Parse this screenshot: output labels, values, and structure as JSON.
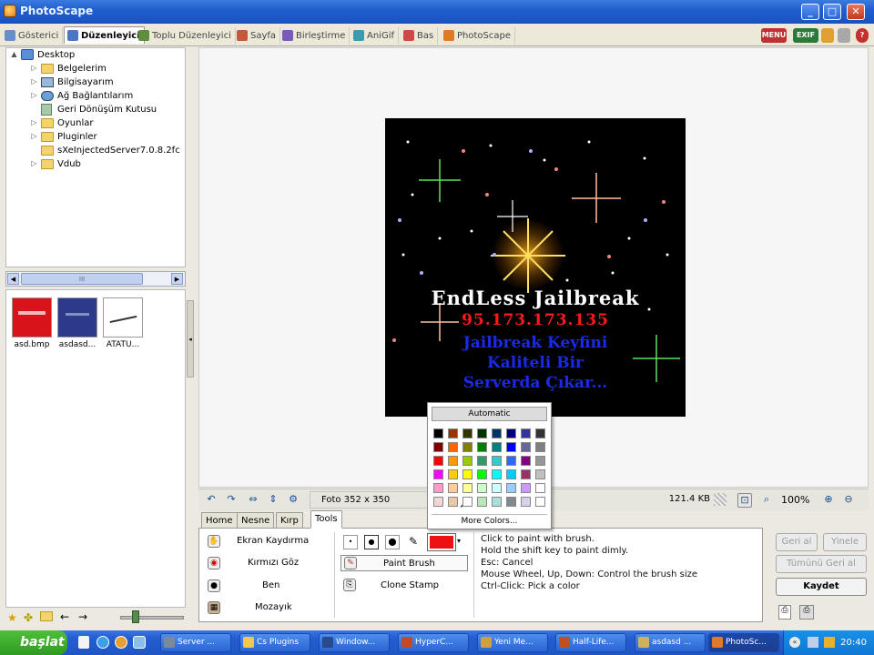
{
  "window": {
    "title": "PhotoScape"
  },
  "tabs": [
    {
      "label": "Gösterici",
      "color": "#6a8fc8"
    },
    {
      "label": "Düzenleyici",
      "color": "#4a76c4"
    },
    {
      "label": "Toplu Düzenleyici",
      "color": "#5e8e3c"
    },
    {
      "label": "Sayfa",
      "color": "#c05a3a"
    },
    {
      "label": "Birleştirme",
      "color": "#7a5ab8"
    },
    {
      "label": "AniGif",
      "color": "#3a9ab2"
    },
    {
      "label": "Bas",
      "color": "#d04848"
    },
    {
      "label": "PhotoScape",
      "color": "#e07a2a"
    }
  ],
  "toolbar_right": {
    "menu": "MENU",
    "exif": "EXIF"
  },
  "tree": [
    {
      "label": "Desktop",
      "expander": "▲",
      "level": 0
    },
    {
      "label": "Belgelerim",
      "expander": "▷",
      "level": 1
    },
    {
      "label": "Bilgisayarım",
      "expander": "▷",
      "level": 1
    },
    {
      "label": "Ağ Bağlantılarım",
      "expander": "▷",
      "level": 1
    },
    {
      "label": "Geri Dönüşüm Kutusu",
      "expander": "",
      "level": 1
    },
    {
      "label": "Oyunlar",
      "expander": "▷",
      "level": 1
    },
    {
      "label": "Pluginler",
      "expander": "▷",
      "level": 1
    },
    {
      "label": "sXeInjectedServer7.0.8.2fc",
      "expander": "",
      "level": 1
    },
    {
      "label": "Vdub",
      "expander": "▷",
      "level": 1
    }
  ],
  "scroll_grip": "III",
  "thumbnails": [
    {
      "caption": "asd.bmp",
      "bg": "#d8141a"
    },
    {
      "caption": "asdasd...",
      "bg": "#2c3a8c"
    },
    {
      "caption": "ATATÜ...",
      "bg": "#ffffff"
    }
  ],
  "photo": {
    "title": "EndLess Jailbreak",
    "ip": "95.173.173.135",
    "line1": "Jailbreak Keyfini",
    "line2": "Kaliteli Bir",
    "line3": "Serverda Çıkar..."
  },
  "statusbar": {
    "photo_size": "Foto 352 x 350",
    "file_size": "121.4 KB",
    "zoom": "100%"
  },
  "tool_tabs": [
    "Home",
    "Nesne",
    "Kırp",
    "Tools"
  ],
  "tools_left": [
    "Ekran Kaydırma",
    "Kırmızı Göz",
    "Ben",
    "Mozayık"
  ],
  "tools_mid": [
    "Paint Brush",
    "Clone Stamp"
  ],
  "brush_color": "#ee1111",
  "help_lines": [
    "Click to paint with brush.",
    "Hold the shift key to paint dimly.",
    "Esc: Cancel",
    "Mouse Wheel, Up, Down: Control the brush size",
    "Ctrl-Click: Pick a color"
  ],
  "right_buttons": {
    "undo": "Geri al",
    "redo": "Yinele",
    "undo_all": "Tümünü Geri al",
    "save": "Kaydet"
  },
  "palette": {
    "automatic": "Automatic",
    "more": "More Colors...",
    "rows": [
      [
        "#000000",
        "#993300",
        "#333300",
        "#003300",
        "#003366",
        "#000080",
        "#333399",
        "#333333"
      ],
      [
        "#800000",
        "#ff6600",
        "#808000",
        "#008000",
        "#008080",
        "#0000ff",
        "#666699",
        "#808080"
      ],
      [
        "#ff0000",
        "#ff9900",
        "#99cc00",
        "#339966",
        "#33cccc",
        "#3366ff",
        "#800080",
        "#969696"
      ],
      [
        "#ff00ff",
        "#ffcc00",
        "#ffff00",
        "#00ff00",
        "#00ffff",
        "#00ccff",
        "#993366",
        "#c0c0c0"
      ],
      [
        "#ff99cc",
        "#ffcc99",
        "#ffff99",
        "#ccffcc",
        "#ccffff",
        "#99ccff",
        "#cc99ff",
        "#ffffff"
      ],
      [
        "#f0d8d8",
        "#e8c8a8",
        "#ffffff",
        "#b8e8b8",
        "#a8e0d8",
        "#808890",
        "#d8d0e8",
        "#ffffff"
      ]
    ]
  },
  "taskbar": {
    "start": "başlat",
    "items": [
      {
        "label": "Server ...",
        "color": "#7a8a9a"
      },
      {
        "label": "Cs Plugins",
        "color": "#f0c850"
      },
      {
        "label": "Window...",
        "color": "#2a4a8a"
      },
      {
        "label": "HyperC...",
        "color": "#c04a2a"
      },
      {
        "label": "Yeni Me...",
        "color": "#d0a040"
      },
      {
        "label": "Half-Life...",
        "color": "#c05020"
      },
      {
        "label": "asdasd ...",
        "color": "#d0b060"
      },
      {
        "label": "PhotoSc...",
        "color": "#e07a2a"
      }
    ],
    "clock": "20:40"
  }
}
